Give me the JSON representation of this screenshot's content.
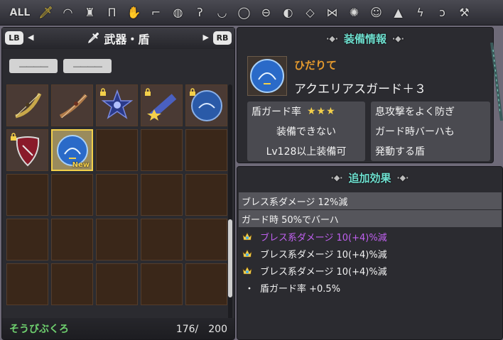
{
  "topbar": {
    "all_label": "ALL",
    "categories": [
      "weapon-shield",
      "head",
      "body-top",
      "body-bottom",
      "arm",
      "leg",
      "face",
      "ear",
      "neck",
      "finger",
      "chest",
      "belt",
      "card",
      "other",
      "crest",
      "monster-card",
      "slime",
      "tool",
      "scythe",
      "hammer"
    ]
  },
  "left": {
    "lb_label": "LB",
    "rb_label": "RB",
    "category_title": "武器・盾",
    "filter1": "――――",
    "filter2": "――――",
    "new_label": "New",
    "bag_name": "そうびぶくろ",
    "bag_count": "176/　200"
  },
  "equip": {
    "title": "装備情報",
    "hand": "ひだりて",
    "name": "アクエリアスガード＋３",
    "guard_label": "盾ガード率",
    "stars": "★★★",
    "cannot_equip": "装備できない",
    "level_req": "Lv128以上装備可",
    "desc1": "息攻撃をよく防ぎ",
    "desc2": "ガード時バーハも",
    "desc3": "発動する盾"
  },
  "effects": {
    "title": "追加効果",
    "base1": "ブレス系ダメージ 12%減",
    "base2": "ガード時 50%でバーハ",
    "row1": "ブレス系ダメージ 10(+4)%減",
    "row2": "ブレス系ダメージ 10(+4)%減",
    "row3": "ブレス系ダメージ 10(+4)%減",
    "row4": "盾ガード率 +0.5%"
  },
  "colors": {
    "accent_title": "#6fe0d0",
    "hand_label": "#e59a2e",
    "purple_effect": "#c060f0",
    "selected": "#f2d04a"
  }
}
